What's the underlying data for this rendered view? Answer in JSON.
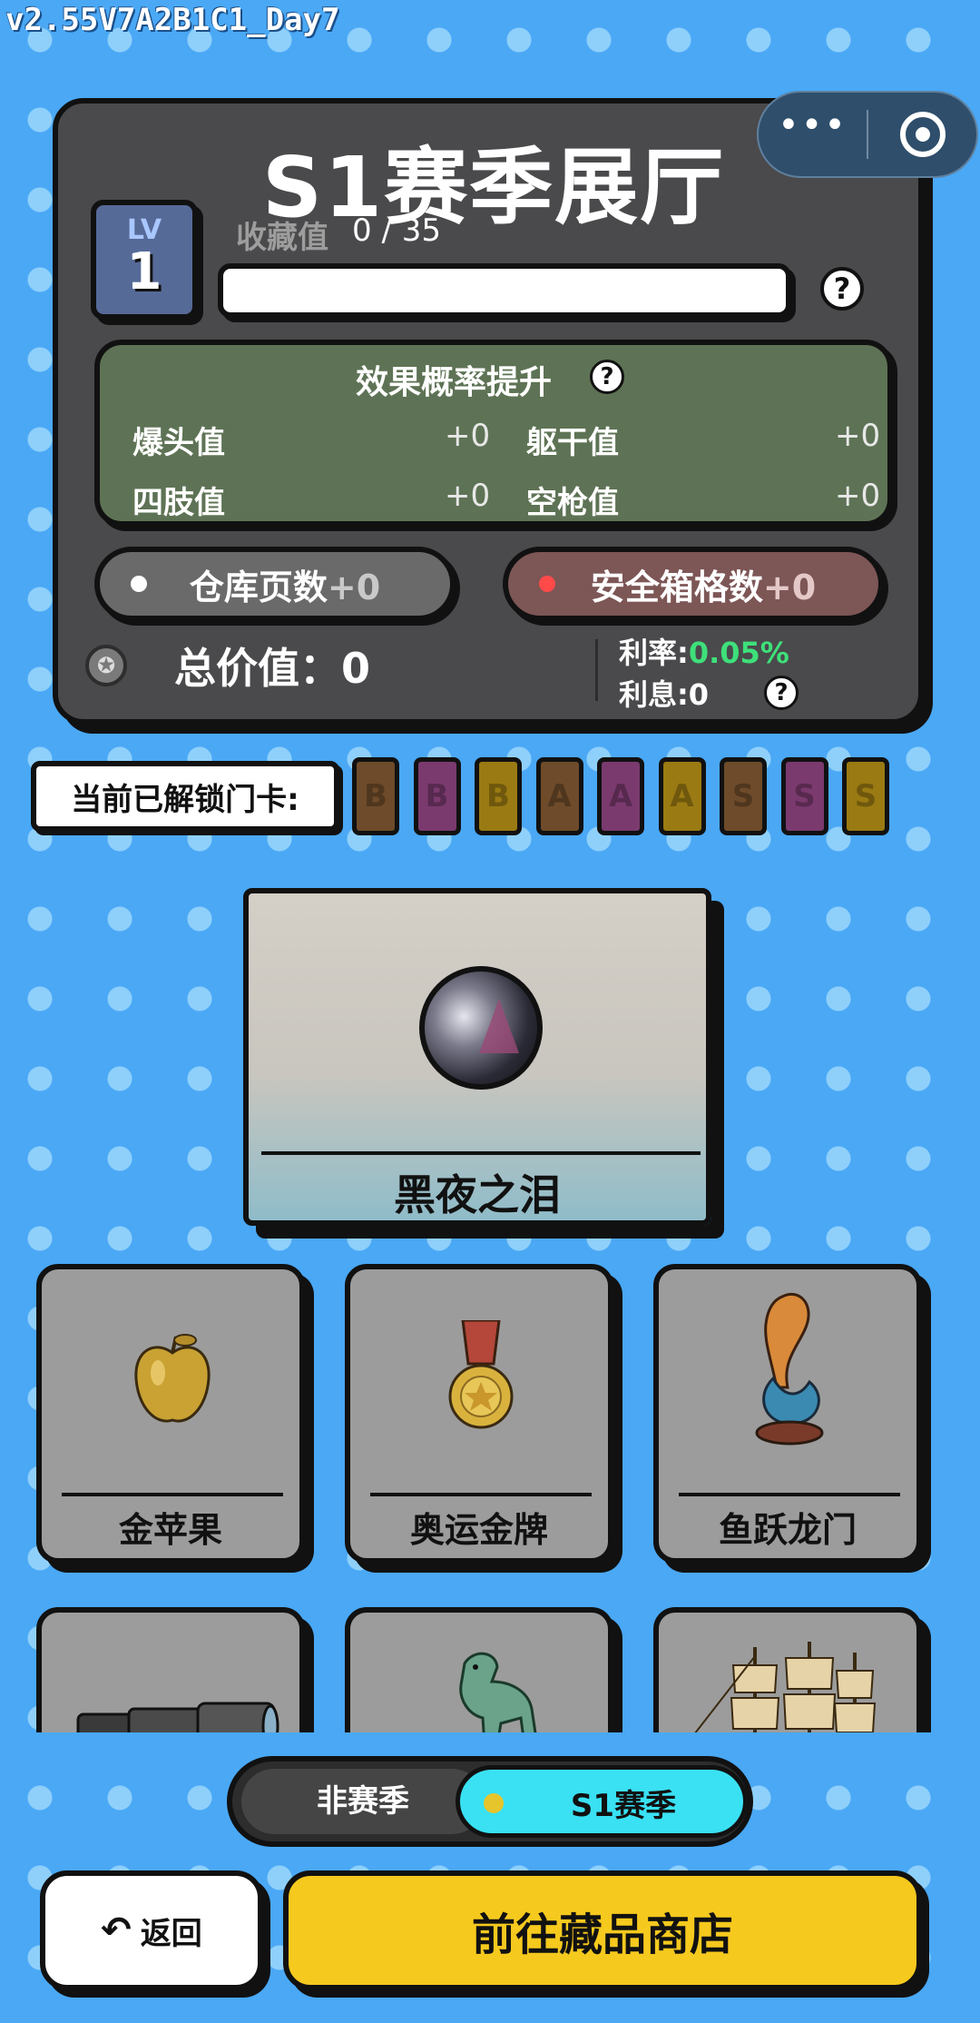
{
  "version": "v2.55V7A2B1C1_Day7",
  "hall": {
    "title": "S1赛季展厅",
    "level_label": "LV",
    "level": "1",
    "collect_label": "收藏值",
    "collect_current": "0",
    "collect_total": "35",
    "collect_value_text": "0 /  35",
    "progress_fraction": 0
  },
  "effect": {
    "title": "效果概率提升",
    "stats": [
      {
        "label": "爆头值",
        "value": "+0"
      },
      {
        "label": "躯干值",
        "value": "+0"
      },
      {
        "label": "四肢值",
        "value": "+0"
      },
      {
        "label": "空枪值",
        "value": "+0"
      }
    ]
  },
  "pills": {
    "warehouse_label": "仓库页数",
    "warehouse_value": "+0",
    "safebox_label": "安全箱格数",
    "safebox_value": "+0"
  },
  "finance": {
    "total_label": "总价值：0",
    "rate_label": "利率:",
    "rate_value": "0.05%",
    "interest_label": "利息:0"
  },
  "unlock": {
    "label": "当前已解锁门卡:",
    "cards": [
      {
        "letter": "B",
        "color": "#6e4b2a"
      },
      {
        "letter": "B",
        "color": "#7a3a6e"
      },
      {
        "letter": "B",
        "color": "#9a7a12"
      },
      {
        "letter": "A",
        "color": "#6e4b2a"
      },
      {
        "letter": "A",
        "color": "#7a3a6e"
      },
      {
        "letter": "A",
        "color": "#9a7a12"
      },
      {
        "letter": "S",
        "color": "#6e4b2a"
      },
      {
        "letter": "S",
        "color": "#7a3a6e"
      },
      {
        "letter": "S",
        "color": "#9a7a12"
      }
    ]
  },
  "featured": {
    "name": "黑夜之泪"
  },
  "items": [
    {
      "name": "金苹果",
      "icon": "golden-apple-icon"
    },
    {
      "name": "奥运金牌",
      "icon": "gold-medal-icon"
    },
    {
      "name": "鱼跃龙门",
      "icon": "koi-statue-icon"
    },
    {
      "name": "",
      "icon": "telescope-icon"
    },
    {
      "name": "",
      "icon": "jade-horse-icon"
    },
    {
      "name": "",
      "icon": "sailing-ship-icon"
    }
  ],
  "season_toggle": {
    "off_season": "非赛季",
    "season": "S1赛季",
    "selected": "S1赛季"
  },
  "buttons": {
    "back": "返回",
    "shop": "前往藏品商店"
  },
  "colors": {
    "background": "#4aa8f5",
    "panel": "#4a4a4c",
    "effect_panel": "#5e7355",
    "accent_yellow": "#f6c91e",
    "accent_cyan": "#39e1f3",
    "rate_green": "#3ee07a"
  }
}
